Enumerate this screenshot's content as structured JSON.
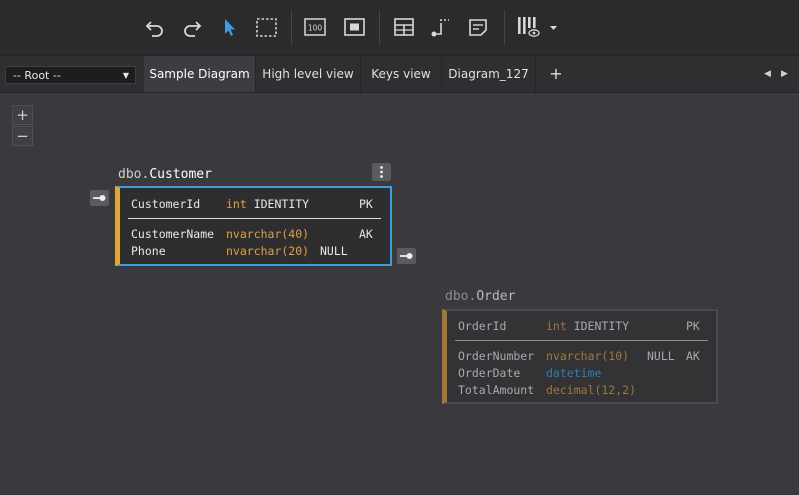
{
  "colors": {
    "background": "#3a3a3e",
    "toolbar": "#2b2b2e",
    "accent_blue": "#3a9fe0",
    "key_yellow": "#e0a82e",
    "type_orange": "#e0a040",
    "type_blue": "#3a9fe0"
  },
  "toolbar": {
    "buttons": [
      {
        "name": "undo-icon"
      },
      {
        "name": "redo-icon"
      },
      {
        "name": "pointer-icon",
        "active": true
      },
      {
        "name": "marquee-select-icon"
      },
      {
        "name": "zoom-100-icon",
        "label": "100"
      },
      {
        "name": "fit-to-screen-icon"
      },
      {
        "name": "add-table-icon"
      },
      {
        "name": "add-relation-icon"
      },
      {
        "name": "add-note-icon"
      },
      {
        "name": "display-mode-icon"
      }
    ]
  },
  "tabbar": {
    "root_select": "-- Root --",
    "tabs": [
      {
        "label": "Sample Diagram",
        "active": true
      },
      {
        "label": "High level view"
      },
      {
        "label": "Keys view"
      },
      {
        "label": "Diagram_127"
      }
    ],
    "add_label": "+"
  },
  "zoom": {
    "plus": "+",
    "minus": "−"
  },
  "entities": {
    "customer": {
      "schema": "dbo.",
      "name": "Customer",
      "pk_rows": [
        {
          "name": "CustomerId",
          "type_kw": "int",
          "type_rest": " IDENTITY",
          "null": "",
          "key": "PK"
        }
      ],
      "rows": [
        {
          "name": "CustomerName",
          "type_kw": "nvarchar(40)",
          "type_rest": "",
          "null": "",
          "key": "AK"
        },
        {
          "name": "Phone",
          "type_kw": "nvarchar(20)",
          "type_rest": "",
          "null": "NULL",
          "key": ""
        }
      ]
    },
    "order": {
      "schema": "dbo.",
      "name": "Order",
      "pk_rows": [
        {
          "name": "OrderId",
          "type_kw": "int",
          "type_rest": " IDENTITY",
          "null": "",
          "key": "PK"
        }
      ],
      "rows": [
        {
          "name": "OrderNumber",
          "type_kw": "nvarchar(10)",
          "type_rest": "",
          "null": "NULL",
          "key": "AK"
        },
        {
          "name": "OrderDate",
          "type_kw": "datetime",
          "type_rest": "",
          "null": "",
          "key": "",
          "type_color": "blue"
        },
        {
          "name": "TotalAmount",
          "type_kw": "decimal(12,2)",
          "type_rest": "",
          "null": "",
          "key": ""
        }
      ]
    }
  }
}
